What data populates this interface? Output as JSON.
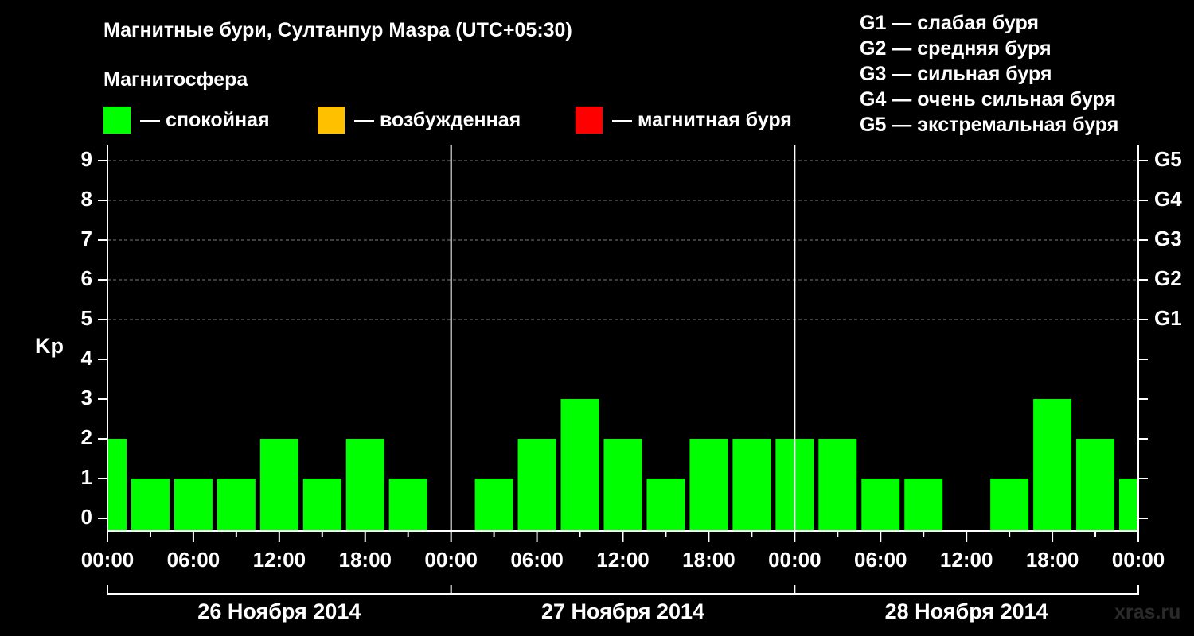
{
  "title": "Магнитные бури, Султанпур Мазра (UTC+05:30)",
  "subtitle": "Магнитосфера",
  "legend": [
    {
      "label": "— спокойная",
      "color": "#00ff00"
    },
    {
      "label": "— возбужденная",
      "color": "#ffc000"
    },
    {
      "label": "— магнитная буря",
      "color": "#ff0000"
    }
  ],
  "storm_scale": [
    "G1 — слабая буря",
    "G2 — средняя буря",
    "G3 — сильная буря",
    "G4 — очень сильная буря",
    "G5 — экстремальная буря"
  ],
  "watermark": "xras.ru",
  "chart_data": {
    "type": "bar",
    "ylabel": "Kp",
    "ylim": [
      0,
      9
    ],
    "y_ticks": [
      "0",
      "1",
      "2",
      "3",
      "4",
      "5",
      "6",
      "7",
      "8",
      "9"
    ],
    "right_ticks": [
      {
        "value": 5,
        "label": "G1"
      },
      {
        "value": 6,
        "label": "G2"
      },
      {
        "value": 7,
        "label": "G3"
      },
      {
        "value": 8,
        "label": "G4"
      },
      {
        "value": 9,
        "label": "G5"
      }
    ],
    "x_tick_labels": [
      "00:00",
      "06:00",
      "12:00",
      "18:00",
      "00:00",
      "06:00",
      "12:00",
      "18:00",
      "00:00",
      "06:00",
      "12:00",
      "18:00",
      "00:00"
    ],
    "days": [
      "26 Ноября 2014",
      "27 Ноября 2014",
      "28 Ноября 2014"
    ],
    "bar_color": "#00ff00",
    "grid": "dashed at Kp 5-9",
    "series": [
      {
        "start_hour": 0.0,
        "end_hour": 1.5,
        "kp": 2
      },
      {
        "start_hour": 1.5,
        "end_hour": 4.5,
        "kp": 1
      },
      {
        "start_hour": 4.5,
        "end_hour": 7.5,
        "kp": 1
      },
      {
        "start_hour": 7.5,
        "end_hour": 10.5,
        "kp": 1
      },
      {
        "start_hour": 10.5,
        "end_hour": 13.5,
        "kp": 2
      },
      {
        "start_hour": 13.5,
        "end_hour": 16.5,
        "kp": 1
      },
      {
        "start_hour": 16.5,
        "end_hour": 19.5,
        "kp": 2
      },
      {
        "start_hour": 19.5,
        "end_hour": 22.5,
        "kp": 1
      },
      {
        "start_hour": 22.5,
        "end_hour": 25.5,
        "kp": 0
      },
      {
        "start_hour": 25.5,
        "end_hour": 28.5,
        "kp": 1
      },
      {
        "start_hour": 28.5,
        "end_hour": 31.5,
        "kp": 2
      },
      {
        "start_hour": 31.5,
        "end_hour": 34.5,
        "kp": 3
      },
      {
        "start_hour": 34.5,
        "end_hour": 37.5,
        "kp": 2
      },
      {
        "start_hour": 37.5,
        "end_hour": 40.5,
        "kp": 1
      },
      {
        "start_hour": 40.5,
        "end_hour": 43.5,
        "kp": 2
      },
      {
        "start_hour": 43.5,
        "end_hour": 46.5,
        "kp": 2
      },
      {
        "start_hour": 46.5,
        "end_hour": 49.5,
        "kp": 2
      },
      {
        "start_hour": 49.5,
        "end_hour": 52.5,
        "kp": 2
      },
      {
        "start_hour": 52.5,
        "end_hour": 55.5,
        "kp": 1
      },
      {
        "start_hour": 55.5,
        "end_hour": 58.5,
        "kp": 1
      },
      {
        "start_hour": 58.5,
        "end_hour": 61.5,
        "kp": 0
      },
      {
        "start_hour": 61.5,
        "end_hour": 64.5,
        "kp": 1
      },
      {
        "start_hour": 64.5,
        "end_hour": 67.5,
        "kp": 3
      },
      {
        "start_hour": 67.5,
        "end_hour": 70.5,
        "kp": 2
      },
      {
        "start_hour": 70.5,
        "end_hour": 72.0,
        "kp": 1
      }
    ]
  }
}
